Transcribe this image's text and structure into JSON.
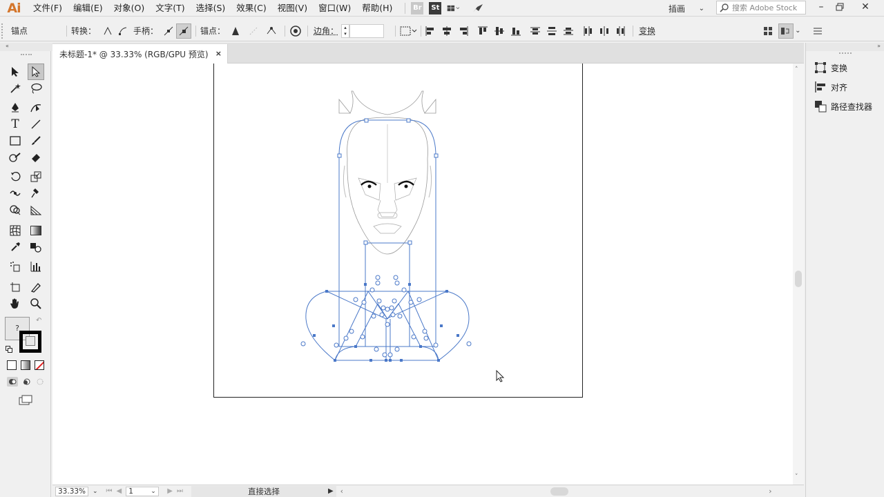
{
  "app": {
    "logo": "Ai"
  },
  "menu": [
    "文件(F)",
    "编辑(E)",
    "对象(O)",
    "文字(T)",
    "选择(S)",
    "效果(C)",
    "视图(V)",
    "窗口(W)",
    "帮助(H)"
  ],
  "menubar_apps": {
    "bridge": "Br",
    "stock": "St"
  },
  "workspace": {
    "label": "插画"
  },
  "search": {
    "placeholder": "搜索 Adobe Stock"
  },
  "control_bar": {
    "context_label": "锚点",
    "convert_label": "转换：",
    "handle_label": "手柄：",
    "anchor_label": "锚点：",
    "corner_label": "边角：",
    "corner_value": "",
    "transform_label": "变换"
  },
  "document": {
    "tab_title": "未标题-1* @ 33.33% (RGB/GPU 预览)",
    "close_glyph": "×"
  },
  "status_bar": {
    "zoom": "33.33%",
    "page": "1",
    "tool_name": "直接选择"
  },
  "right_panel": {
    "items": [
      {
        "label": "变换",
        "icon": "transform-icon"
      },
      {
        "label": "对齐",
        "icon": "align-icon"
      },
      {
        "label": "路径查找器",
        "icon": "pathfinder-icon"
      }
    ]
  },
  "colors": {
    "logo": "#d4762c",
    "selection": "#4a78c8",
    "background": "#f0f0f0",
    "canvas": "#ffffff"
  }
}
